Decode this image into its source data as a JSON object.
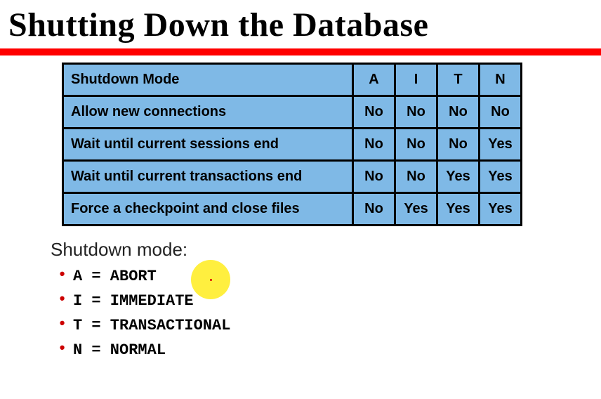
{
  "title": "Shutting Down the Database",
  "chart_data": {
    "type": "table",
    "header": {
      "label": "Shutdown Mode",
      "modes": [
        "A",
        "I",
        "T",
        "N"
      ]
    },
    "rows": [
      {
        "label": "Allow new connections",
        "values": [
          "No",
          "No",
          "No",
          "No"
        ]
      },
      {
        "label": "Wait until current sessions end",
        "values": [
          "No",
          "No",
          "No",
          "Yes"
        ]
      },
      {
        "label": "Wait until current transactions end",
        "values": [
          "No",
          "No",
          "Yes",
          "Yes"
        ]
      },
      {
        "label": "Force a checkpoint and close files",
        "values": [
          "No",
          "Yes",
          "Yes",
          "Yes"
        ]
      }
    ]
  },
  "legend": {
    "title": "Shutdown mode:",
    "items": [
      "A = ABORT",
      "I = IMMEDIATE",
      "T = TRANSACTIONAL",
      "N = NORMAL"
    ]
  }
}
